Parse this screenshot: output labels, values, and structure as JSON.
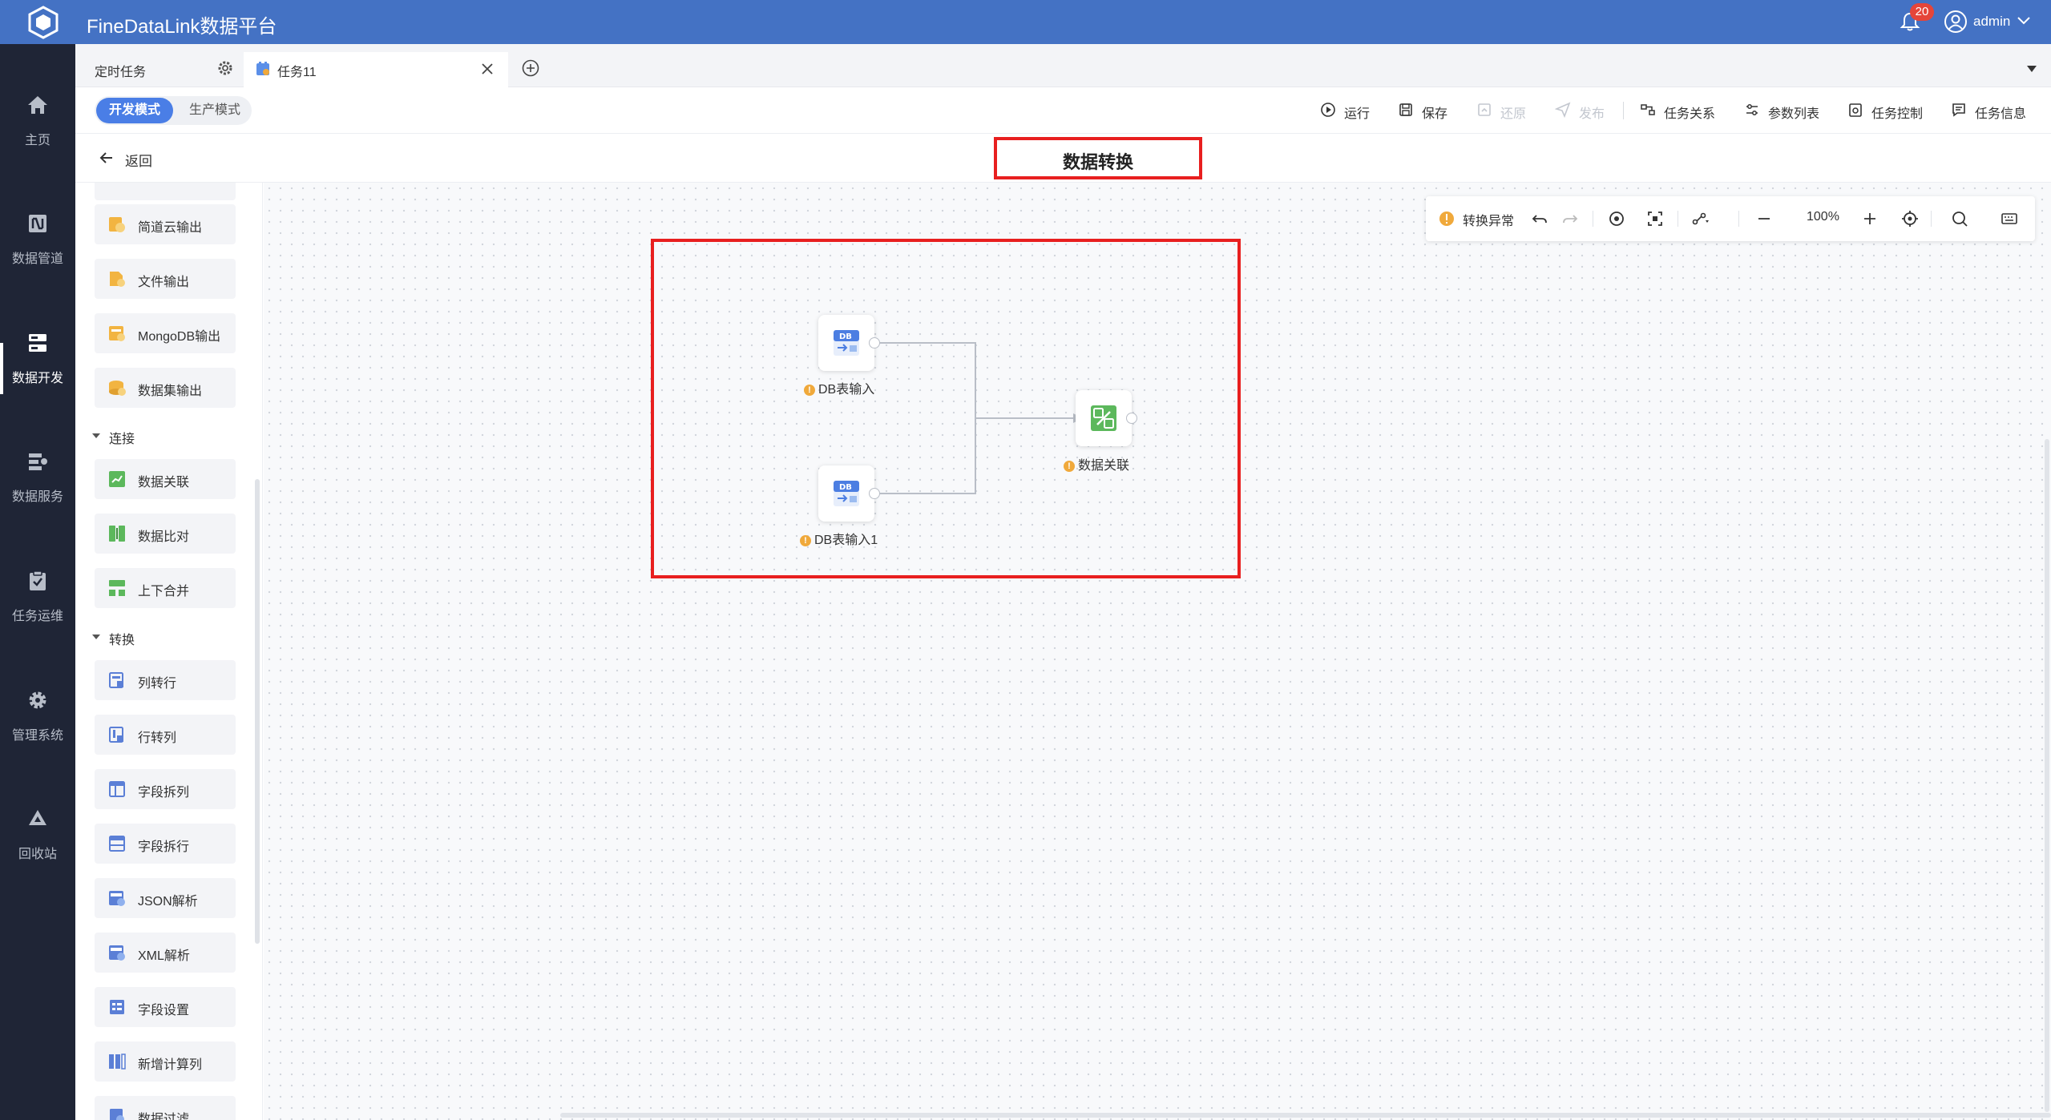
{
  "header": {
    "app_title": "FineDataLink数据平台",
    "notification_count": "20",
    "username": "admin"
  },
  "nav": {
    "items": [
      {
        "label": "主页",
        "icon": "home-icon"
      },
      {
        "label": "数据管道",
        "icon": "pipeline-icon"
      },
      {
        "label": "数据开发",
        "icon": "data-dev-icon",
        "active": true
      },
      {
        "label": "数据服务",
        "icon": "data-service-icon"
      },
      {
        "label": "任务运维",
        "icon": "task-ops-icon"
      },
      {
        "label": "管理系统",
        "icon": "gear-icon"
      },
      {
        "label": "回收站",
        "icon": "recycle-icon"
      }
    ]
  },
  "tabs": [
    {
      "label": "定时任务"
    },
    {
      "label": "任务11"
    }
  ],
  "toolbar": {
    "mode_dev": "开发模式",
    "mode_prod": "生产模式",
    "run": "运行",
    "save": "保存",
    "restore": "还原",
    "publish": "发布",
    "task_relations": "任务关系",
    "param_list": "参数列表",
    "task_control": "任务控制",
    "task_info": "任务信息"
  },
  "breadcrumb": {
    "back": "返回",
    "title": "数据转换"
  },
  "panel": {
    "items_top": [
      "简道云输出",
      "文件输出",
      "MongoDB输出",
      "数据集输出"
    ],
    "group_connect": "连接",
    "items_connect": [
      "数据关联",
      "数据比对",
      "上下合并"
    ],
    "group_transform": "转换",
    "items_transform": [
      "列转行",
      "行转列",
      "字段拆列",
      "字段拆行",
      "JSON解析",
      "XML解析",
      "字段设置",
      "新增计算列",
      "数据过滤"
    ]
  },
  "canvas": {
    "status": "转换异常",
    "zoom": "100%",
    "nodes": [
      {
        "label": "DB表输入",
        "icon": "db-input-icon"
      },
      {
        "label": "DB表输入1",
        "icon": "db-input-icon"
      },
      {
        "label": "数据关联",
        "icon": "data-join-icon"
      }
    ]
  },
  "colors": {
    "header_bg": "#4472c4",
    "nav_bg": "#1f2536",
    "accent": "#4a7ee6",
    "highlight_border": "#e81f1f",
    "warning": "#f0a93b"
  }
}
